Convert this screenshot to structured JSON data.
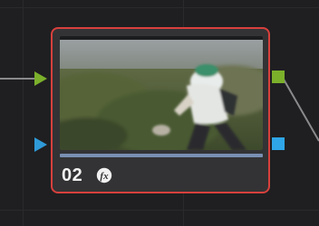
{
  "node": {
    "label": "02",
    "fx_icon": "fx-icon",
    "selected": true,
    "border_color": "#d7403d",
    "thumbnail": "cyclist-video-frame",
    "progress": 1.0
  },
  "ports": {
    "rgb_input_color": "#7bb02b",
    "alpha_input_color": "#2f9ad8",
    "rgb_output_color": "#7bb02b",
    "alpha_output_color": "#2fa6e8"
  },
  "fx_glyph": "fx"
}
